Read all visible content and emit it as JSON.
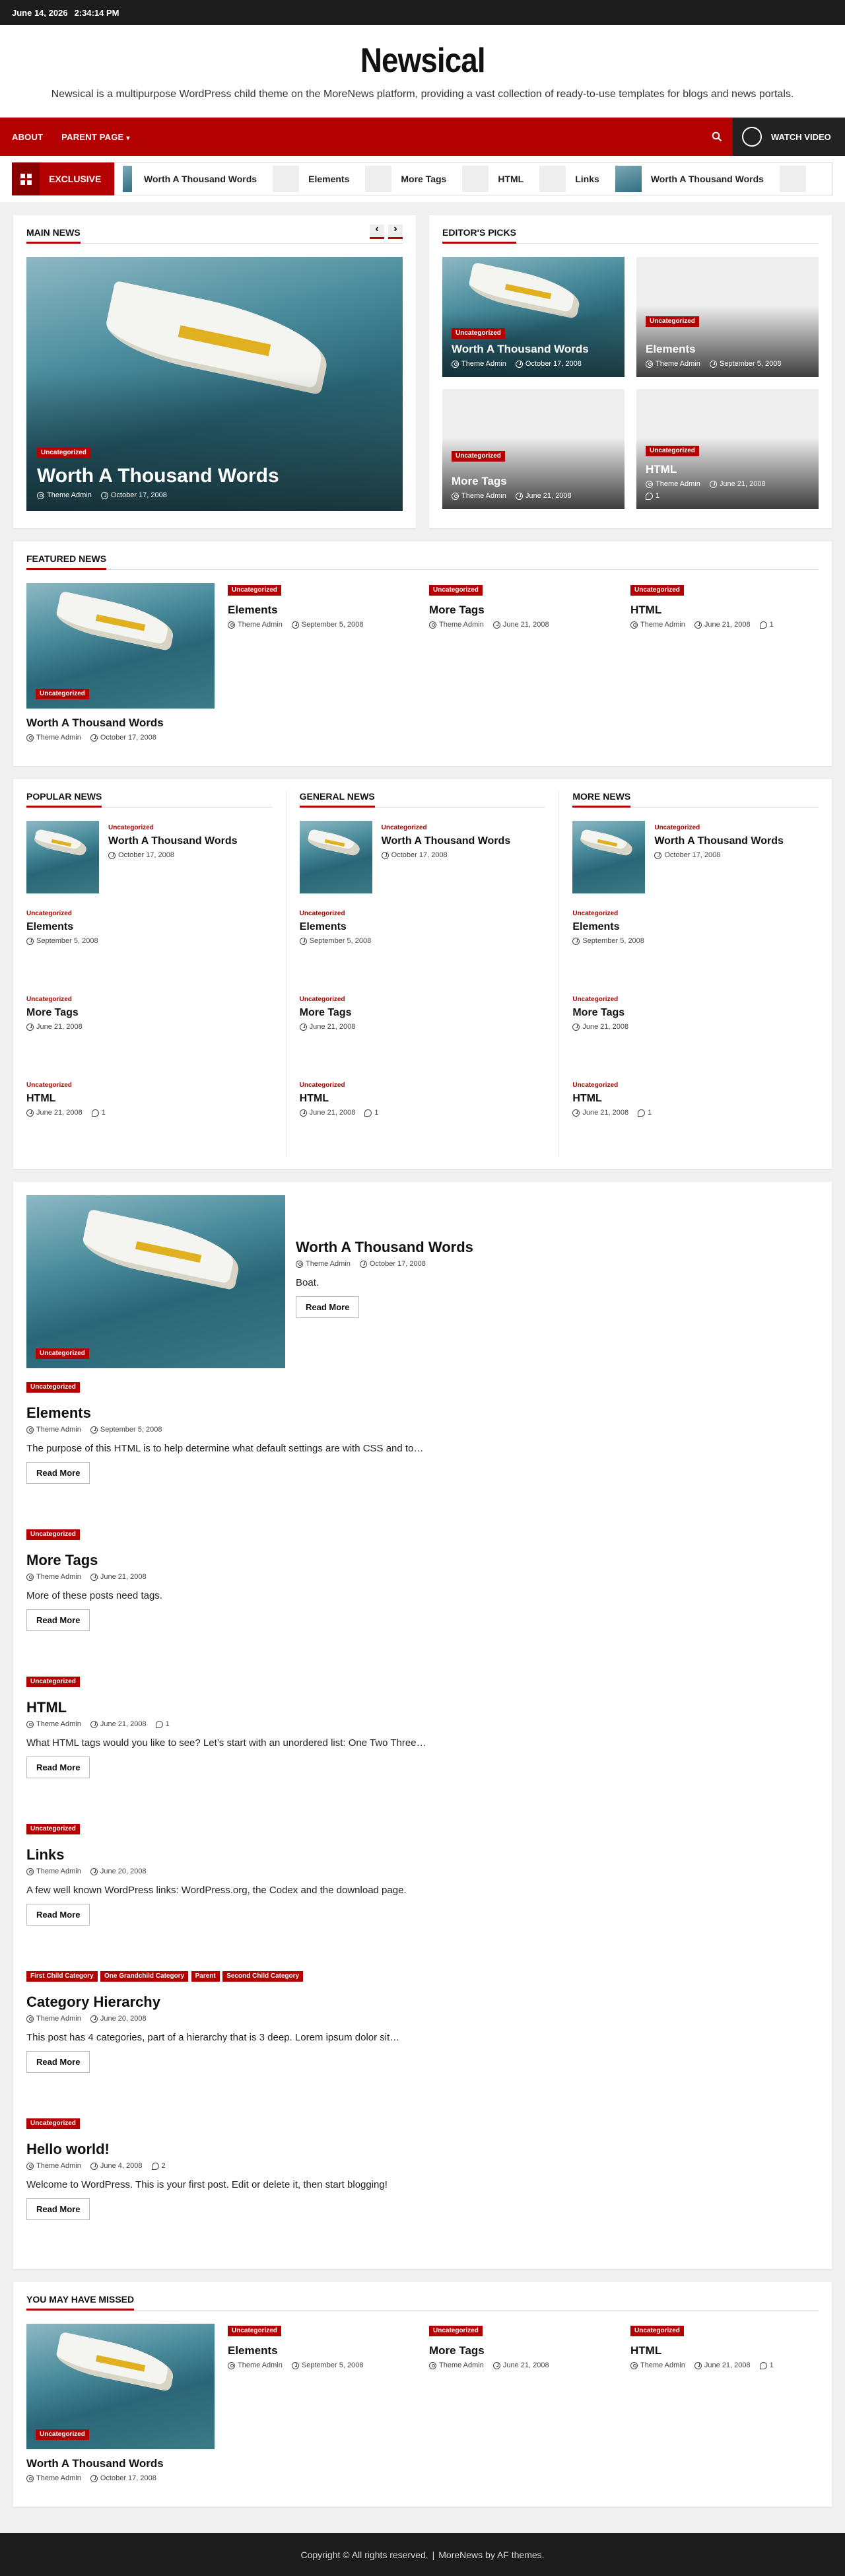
{
  "topbar": {
    "date": "June 14, 2026",
    "time": "2:34:14 PM"
  },
  "site": {
    "title": "Newsical",
    "tagline": "Newsical is a multipurpose WordPress child theme on the MoreNews platform, providing a vast collection of ready-to-use templates for blogs and news portals."
  },
  "nav": {
    "items": [
      "ABOUT",
      "PARENT PAGE"
    ],
    "watch_video": "WATCH VIDEO",
    "search_icon": "search-icon"
  },
  "ticker": {
    "label": "EXCLUSIVE",
    "items": [
      "Worth A Thousand Words",
      "Elements",
      "More Tags",
      "HTML",
      "Links",
      "Worth A Thousand Words"
    ]
  },
  "main_news": {
    "title": "MAIN NEWS",
    "prev": "‹",
    "next": "›",
    "post": {
      "category": "Uncategorized",
      "title": "Worth A Thousand Words",
      "author": "Theme Admin",
      "date": "October 17, 2008"
    }
  },
  "editors_picks": {
    "title": "EDITOR'S PICKS",
    "posts": [
      {
        "category": "Uncategorized",
        "title": "Worth A Thousand Words",
        "author": "Theme Admin",
        "date": "October 17, 2008"
      },
      {
        "category": "Uncategorized",
        "title": "Elements",
        "author": "Theme Admin",
        "date": "September 5, 2008"
      },
      {
        "category": "Uncategorized",
        "title": "More Tags",
        "author": "Theme Admin",
        "date": "June 21, 2008"
      },
      {
        "category": "Uncategorized",
        "title": "HTML",
        "author": "Theme Admin",
        "date": "June 21, 2008",
        "comments": "1"
      }
    ]
  },
  "featured": {
    "title": "FEATURED NEWS",
    "lead": {
      "category": "Uncategorized",
      "title": "Worth A Thousand Words",
      "author": "Theme Admin",
      "date": "October 17, 2008"
    },
    "posts": [
      {
        "category": "Uncategorized",
        "title": "Elements",
        "author": "Theme Admin",
        "date": "September 5, 2008"
      },
      {
        "category": "Uncategorized",
        "title": "More Tags",
        "author": "Theme Admin",
        "date": "June 21, 2008"
      },
      {
        "category": "Uncategorized",
        "title": "HTML",
        "author": "Theme Admin",
        "date": "June 21, 2008",
        "comments": "1"
      }
    ]
  },
  "columns": [
    {
      "title": "POPULAR NEWS",
      "lead": {
        "category": "Uncategorized",
        "title": "Worth A Thousand Words",
        "date": "October 17, 2008"
      },
      "posts": [
        {
          "category": "Uncategorized",
          "title": "Elements",
          "date": "September 5, 2008"
        },
        {
          "category": "Uncategorized",
          "title": "More Tags",
          "date": "June 21, 2008"
        },
        {
          "category": "Uncategorized",
          "title": "HTML",
          "date": "June 21, 2008",
          "comments": "1"
        }
      ]
    },
    {
      "title": "GENERAL NEWS",
      "lead": {
        "category": "Uncategorized",
        "title": "Worth A Thousand Words",
        "date": "October 17, 2008"
      },
      "posts": [
        {
          "category": "Uncategorized",
          "title": "Elements",
          "date": "September 5, 2008"
        },
        {
          "category": "Uncategorized",
          "title": "More Tags",
          "date": "June 21, 2008"
        },
        {
          "category": "Uncategorized",
          "title": "HTML",
          "date": "June 21, 2008",
          "comments": "1"
        }
      ]
    },
    {
      "title": "MORE NEWS",
      "lead": {
        "category": "Uncategorized",
        "title": "Worth A Thousand Words",
        "date": "October 17, 2008"
      },
      "posts": [
        {
          "category": "Uncategorized",
          "title": "Elements",
          "date": "September 5, 2008"
        },
        {
          "category": "Uncategorized",
          "title": "More Tags",
          "date": "June 21, 2008"
        },
        {
          "category": "Uncategorized",
          "title": "HTML",
          "date": "June 21, 2008",
          "comments": "1"
        }
      ]
    }
  ],
  "posts_list": {
    "read_more": "Read More",
    "lead": {
      "category": "Uncategorized",
      "title": "Worth A Thousand Words",
      "author": "Theme Admin",
      "date": "October 17, 2008",
      "excerpt": "Boat."
    },
    "items": [
      {
        "categories": [
          "Uncategorized"
        ],
        "title": "Elements",
        "author": "Theme Admin",
        "date": "September 5, 2008",
        "excerpt": "The purpose of this HTML is to help determine what default settings are with CSS and to…"
      },
      {
        "categories": [
          "Uncategorized"
        ],
        "title": "More Tags",
        "author": "Theme Admin",
        "date": "June 21, 2008",
        "excerpt": "More of these posts need tags."
      },
      {
        "categories": [
          "Uncategorized"
        ],
        "title": "HTML",
        "author": "Theme Admin",
        "date": "June 21, 2008",
        "comments": "1",
        "excerpt": "What HTML tags would you like to see? Let’s start with an unordered list: One Two Three…"
      },
      {
        "categories": [
          "Uncategorized"
        ],
        "title": "Links",
        "author": "Theme Admin",
        "date": "June 20, 2008",
        "excerpt": "A few well known WordPress links: WordPress.org, the Codex and the download page."
      },
      {
        "categories": [
          "First Child Category",
          "One Grandchild Category",
          "Parent",
          "Second Child Category"
        ],
        "title": "Category Hierarchy",
        "author": "Theme Admin",
        "date": "June 20, 2008",
        "excerpt": "This post has 4 categories, part of a hierarchy that is 3 deep. Lorem ipsum dolor sit…"
      },
      {
        "categories": [
          "Uncategorized"
        ],
        "title": "Hello world!",
        "author": "Theme Admin",
        "date": "June 4, 2008",
        "comments": "2",
        "excerpt": "Welcome to WordPress. This is your first post. Edit or delete it, then start blogging!"
      }
    ]
  },
  "missed": {
    "title": "YOU MAY HAVE MISSED",
    "lead": {
      "category": "Uncategorized",
      "title": "Worth A Thousand Words",
      "author": "Theme Admin",
      "date": "October 17, 2008"
    },
    "posts": [
      {
        "category": "Uncategorized",
        "title": "Elements",
        "author": "Theme Admin",
        "date": "September 5, 2008"
      },
      {
        "category": "Uncategorized",
        "title": "More Tags",
        "author": "Theme Admin",
        "date": "June 21, 2008"
      },
      {
        "category": "Uncategorized",
        "title": "HTML",
        "author": "Theme Admin",
        "date": "June 21, 2008",
        "comments": "1"
      }
    ]
  },
  "footer": {
    "copyright": "Copyright © All rights reserved.",
    "separator": "|",
    "credit": "MoreNews by AF themes."
  },
  "colors": {
    "accent": "#b30000",
    "dark": "#1c1c1c"
  }
}
